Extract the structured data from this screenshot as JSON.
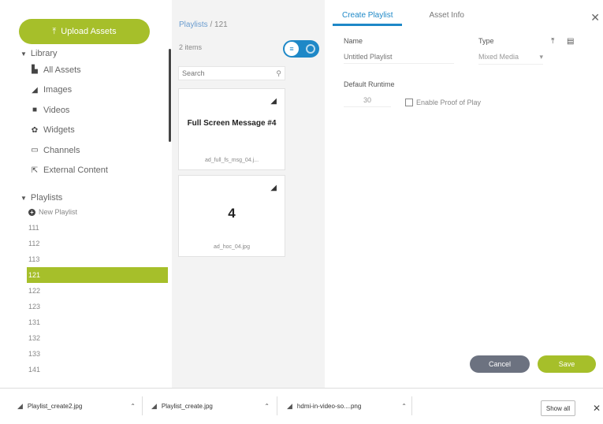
{
  "sidebar": {
    "upload_label": "Upload Assets",
    "library_label": "Library",
    "library_items": [
      {
        "icon": "image-stack-icon",
        "label": "All Assets"
      },
      {
        "icon": "image-icon",
        "label": "Images"
      },
      {
        "icon": "video-icon",
        "label": "Videos"
      },
      {
        "icon": "gear-icon",
        "label": "Widgets"
      },
      {
        "icon": "monitor-icon",
        "label": "Channels"
      },
      {
        "icon": "external-icon",
        "label": "External Content"
      }
    ],
    "playlists_label": "Playlists",
    "new_playlist_label": "New Playlist",
    "playlists": [
      "111",
      "112",
      "113",
      "121",
      "122",
      "123",
      "131",
      "132",
      "133",
      "141"
    ],
    "active_playlist": "121"
  },
  "middle": {
    "breadcrumb_root": "Playlists",
    "breadcrumb_sep": "/",
    "breadcrumb_current": "121",
    "items_count": "2 items",
    "search_placeholder": "Search",
    "cards": [
      {
        "title": "Full Screen Message #4",
        "file": "ad_full_fs_msg_04.j..."
      },
      {
        "title": "4",
        "file": "ad_hoc_04.jpg"
      }
    ]
  },
  "panel": {
    "tabs": [
      "Create Playlist",
      "Asset Info"
    ],
    "active_tab": "Create Playlist",
    "name_label": "Name",
    "name_placeholder": "Untitled Playlist",
    "type_label": "Type",
    "type_value": "Mixed Media",
    "runtime_label": "Default Runtime",
    "runtime_value": "30",
    "proof_label": "Enable Proof of Play",
    "cancel_label": "Cancel",
    "save_label": "Save"
  },
  "downloads": {
    "items": [
      "Playlist_create2.jpg",
      "Playlist_create.jpg",
      "hdmi-in-video-so....png"
    ],
    "show_all_label": "Show all"
  },
  "colors": {
    "accent_green": "#a6bf2a",
    "accent_blue": "#1e88c7",
    "button_gray": "#6c7280"
  }
}
